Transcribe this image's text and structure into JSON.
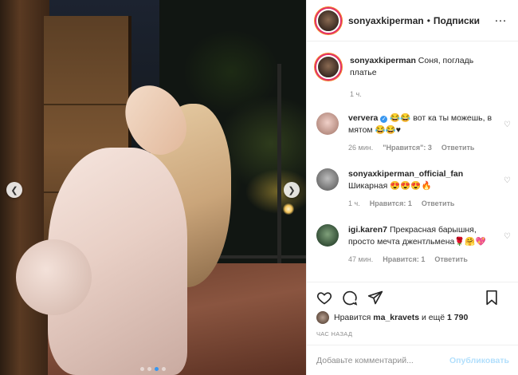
{
  "post": {
    "photo_icon": "photo",
    "carousel": {
      "slide_count": 4,
      "active_index": 2
    }
  },
  "header": {
    "username": "sonyaxkiperman",
    "separator": "•",
    "follow_label": "Подписки",
    "more_icon": "more-horizontal-icon"
  },
  "comments": [
    {
      "username": "sonyaxkiperman",
      "text": "Соня, погладь платье",
      "time": "1 ч.",
      "is_caption": true
    },
    {
      "username": "ververa",
      "verified": true,
      "text": "😂😂 вот ка ты можешь, в мятом 😂😂♥",
      "time": "26 мин.",
      "likes_label": "\"Нравится\": 3",
      "reply_label": "Ответить"
    },
    {
      "username": "sonyaxkiperman_official_fan",
      "text": "Шикарная 😍😍😍🔥",
      "time": "1 ч.",
      "likes_label": "Нравится: 1",
      "reply_label": "Ответить"
    },
    {
      "username": "igi.karen7",
      "text": "Прекрасная барышня, просто мечта джентльмена🌹🤗💖",
      "time": "47 мин.",
      "likes_label": "Нравится: 1",
      "reply_label": "Ответить"
    }
  ],
  "likes": {
    "prefix": "Нравится",
    "liker": "ma_kravets",
    "suffix": "и ещё",
    "count": "1 790"
  },
  "timestamp": "ЧАС НАЗАД",
  "add_comment": {
    "placeholder": "Добавьте комментарий...",
    "publish_label": "Опубликовать"
  },
  "colors": {
    "accent_blue": "#3897f0",
    "publish_disabled": "#b2dffc",
    "secondary_text": "#8e8e8e"
  }
}
